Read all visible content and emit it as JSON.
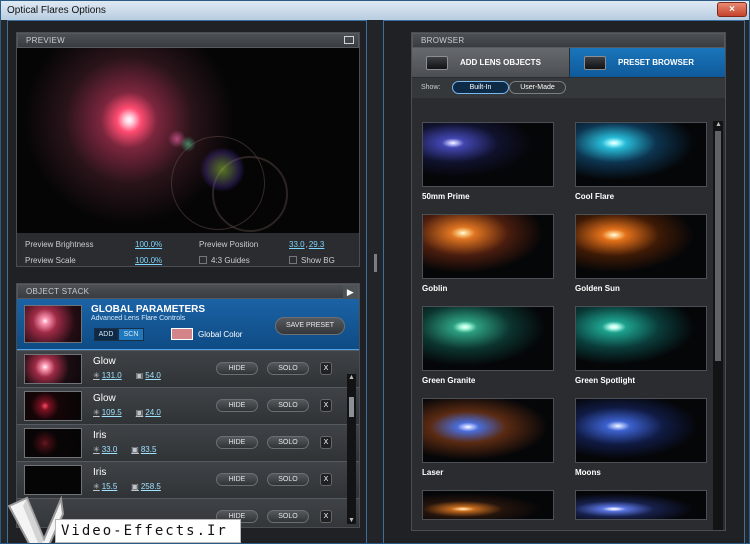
{
  "window": {
    "title": "Optical Flares Options",
    "close": "×"
  },
  "preview": {
    "header": "PREVIEW",
    "brightness_label": "Preview Brightness",
    "brightness_value": "100.0%",
    "position_label": "Preview Position",
    "position_x": "33.0",
    "position_sep": ",",
    "position_y": "29.3",
    "scale_label": "Preview Scale",
    "scale_value": "100.0%",
    "guides_label": "4:3 Guides",
    "show_bg_label": "Show BG"
  },
  "stack": {
    "header": "OBJECT STACK",
    "global": {
      "title": "GLOBAL PARAMETERS",
      "subtitle": "Advanced Lens Flare Controls",
      "add": "ADD",
      "scn": "SCN",
      "color_label": "Global Color",
      "save": "SAVE PRESET"
    },
    "rows": [
      {
        "name": "Glow",
        "v1": "131.0",
        "v2": "54.0",
        "hide": "HIDE",
        "solo": "SOLO",
        "x": "X"
      },
      {
        "name": "Glow",
        "v1": "109.5",
        "v2": "24.0",
        "hide": "HIDE",
        "solo": "SOLO",
        "x": "X"
      },
      {
        "name": "Iris",
        "v1": "33.0",
        "v2": "83.5",
        "hide": "HIDE",
        "solo": "SOLO",
        "x": "X"
      },
      {
        "name": "Iris",
        "v1": "15.5",
        "v2": "258.5",
        "hide": "HIDE",
        "solo": "SOLO",
        "x": "X"
      },
      {
        "name": "",
        "v1": "",
        "v2": "",
        "hide": "HIDE",
        "solo": "SOLO",
        "x": "X"
      }
    ]
  },
  "watermark": {
    "text": "Video-Effects.Ir"
  },
  "browser": {
    "header": "BROWSER",
    "tab_add": "ADD LENS OBJECTS",
    "tab_preset": "PRESET BROWSER",
    "show_label": "Show:",
    "builtin": "Built-In",
    "usermade": "User-Made",
    "items": [
      "50mm Prime",
      "Cool Flare",
      "Goblin",
      "Golden Sun",
      "Green Granite",
      "Green Spotlight",
      "Laser",
      "Moons"
    ]
  }
}
